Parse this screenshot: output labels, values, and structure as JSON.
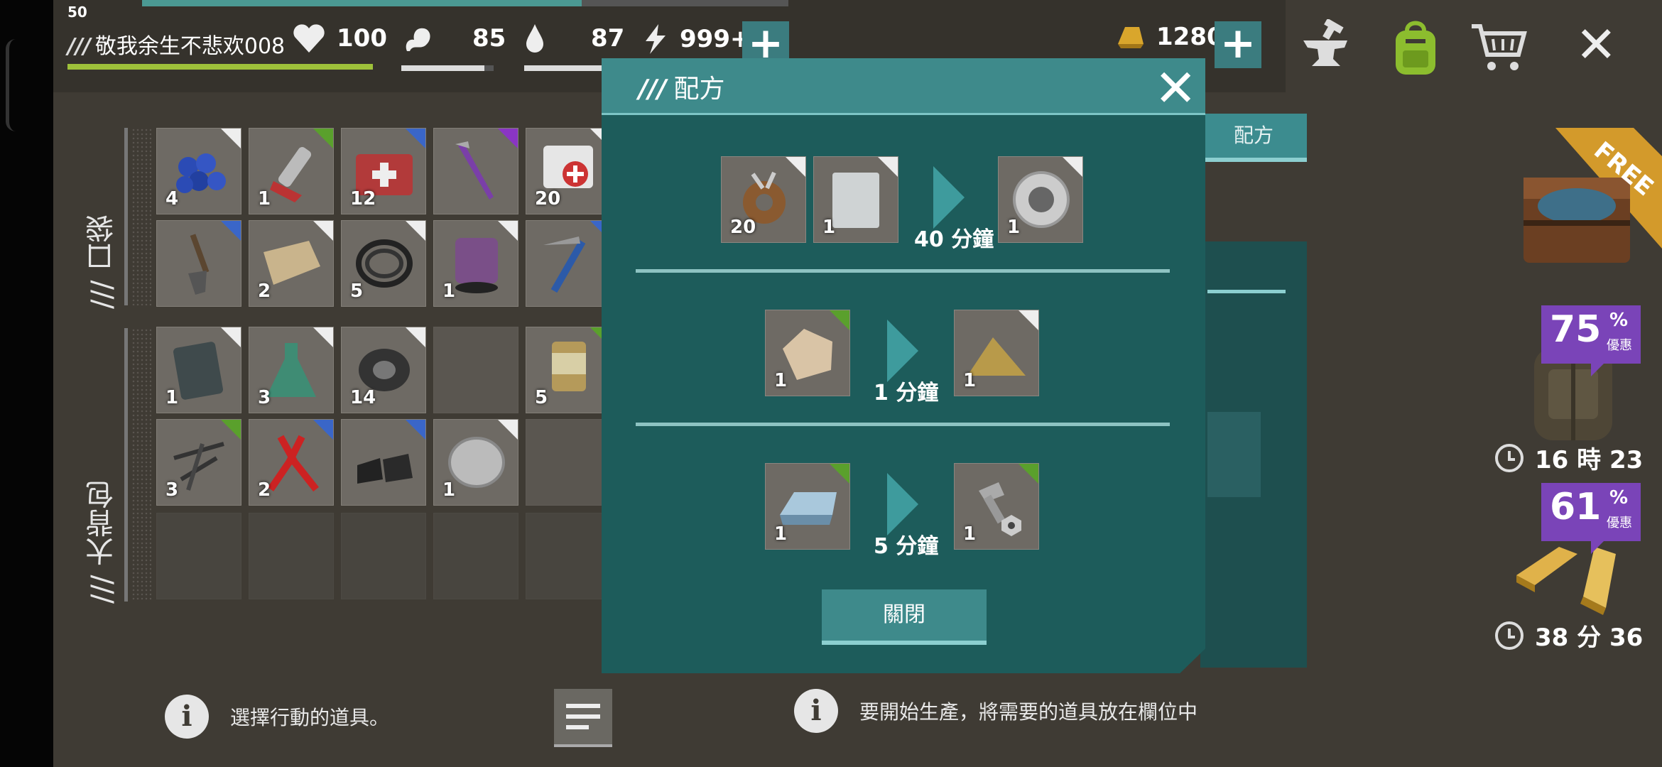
{
  "player": {
    "level": "50",
    "name_prefix": "///",
    "name": "敬我余生不悲欢008",
    "xp_fraction": 0.68
  },
  "stats": {
    "health": "100",
    "food": "85",
    "water": "87",
    "energy": "999+",
    "health_fraction": 1.0,
    "food_fraction": 0.9,
    "water_fraction": 0.95
  },
  "currency": {
    "gold": "1280"
  },
  "sections": {
    "pocket": "/// 口袋",
    "backpack": "/// 大背包"
  },
  "pocket_items": [
    {
      "name": "blueberries-icon",
      "qty": "4",
      "rarity": "#eeeeee"
    },
    {
      "name": "chainsaw-icon",
      "qty": "1",
      "rarity": "#5aa02c"
    },
    {
      "name": "first-aid-kit-icon",
      "qty": "12",
      "rarity": "#3a66c8"
    },
    {
      "name": "crowbar-icon",
      "qty": "",
      "rarity": "#8a35c4"
    },
    {
      "name": "bandage-icon",
      "qty": "20",
      "rarity": "#eeeeee"
    },
    {
      "name": "shovel-icon",
      "qty": "",
      "rarity": "#3a66c8"
    },
    {
      "name": "cloth-icon",
      "qty": "2",
      "rarity": "#eeeeee"
    },
    {
      "name": "rope-icon",
      "qty": "5",
      "rarity": "#eeeeee"
    },
    {
      "name": "paint-can-icon",
      "qty": "1",
      "rarity": "#eeeeee"
    },
    {
      "name": "ice-axe-icon",
      "qty": "",
      "rarity": "#3a66c8"
    }
  ],
  "backpack_items": [
    {
      "name": "metal-plate-icon",
      "qty": "1",
      "rarity": "#eeeeee"
    },
    {
      "name": "chemical-flask-icon",
      "qty": "3",
      "rarity": "#eeeeee"
    },
    {
      "name": "duct-tape-icon",
      "qty": "14",
      "rarity": "#eeeeee"
    },
    {
      "name": "empty-slot",
      "qty": "",
      "rarity": ""
    },
    {
      "name": "pills-jar-icon",
      "qty": "5",
      "rarity": "#5aa02c"
    },
    {
      "name": "nails-icon",
      "qty": "3",
      "rarity": "#5aa02c"
    },
    {
      "name": "pliers-icon",
      "qty": "2",
      "rarity": "#3a66c8"
    },
    {
      "name": "boots-icon",
      "qty": "",
      "rarity": "#3a66c8"
    },
    {
      "name": "lens-icon",
      "qty": "1",
      "rarity": "#eeeeee"
    },
    {
      "name": "empty-slot",
      "qty": "",
      "rarity": ""
    }
  ],
  "hints": {
    "left": "選擇行動的道具。",
    "right": "要開始生產，將需要的道具放在欄位中"
  },
  "behind": {
    "tab": "配方"
  },
  "dialog": {
    "title_prefix": "///",
    "title": "配方",
    "close_button": "關閉",
    "recipes": [
      {
        "inputs": [
          {
            "name": "scrap-gears-icon",
            "qty": "20",
            "rarity": "#eeeeee"
          },
          {
            "name": "metal-sheet-icon",
            "qty": "1",
            "rarity": "#eeeeee"
          }
        ],
        "time": "40 分鐘",
        "output": {
          "name": "bearing-icon",
          "qty": "1",
          "rarity": "#eeeeee"
        }
      },
      {
        "inputs": [
          {
            "name": "stone-icon",
            "qty": "1",
            "rarity": "#5aa02c"
          }
        ],
        "time": "1 分鐘",
        "output": {
          "name": "sand-pile-icon",
          "qty": "1",
          "rarity": "#eeeeee"
        }
      },
      {
        "inputs": [
          {
            "name": "iron-ingot-icon",
            "qty": "1",
            "rarity": "#5aa02c"
          }
        ],
        "time": "5 分鐘",
        "output": {
          "name": "bolt-nut-icon",
          "qty": "1",
          "rarity": "#5aa02c"
        }
      }
    ]
  },
  "shop": {
    "free_label": "FREE",
    "offers": [
      {
        "percent": "75",
        "percent_sign": "%",
        "off_label": "優惠",
        "timer": "16 時 23"
      },
      {
        "percent": "61",
        "percent_sign": "%",
        "off_label": "優惠",
        "timer": "38 分 36"
      }
    ]
  },
  "colors": {
    "accent": "#3e8a8b",
    "panel": "#1d5c5b",
    "bg": "#3f3b34",
    "health_bar": "#9ec13a",
    "purple": "#7a44b8"
  }
}
